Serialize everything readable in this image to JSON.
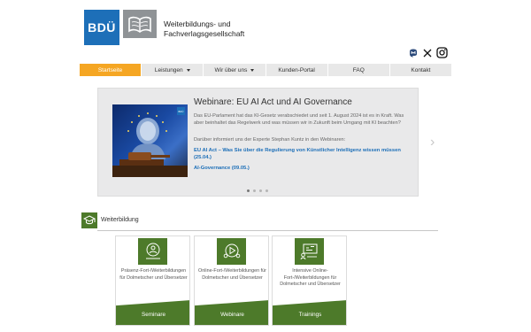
{
  "header": {
    "logo_text": "BDÜ",
    "org_line1": "Weiterbildungs- und",
    "org_line2": "Fachverlagsgesellschaft",
    "social_icons": [
      "mastodon-icon",
      "x-icon",
      "instagram-icon"
    ]
  },
  "nav": {
    "items": [
      {
        "label": "Startseite",
        "active": true,
        "dropdown": false
      },
      {
        "label": "Leistungen",
        "active": false,
        "dropdown": true
      },
      {
        "label": "Wir über uns",
        "active": false,
        "dropdown": true
      },
      {
        "label": "Kunden-Portal",
        "active": false,
        "dropdown": false
      },
      {
        "label": "FAQ",
        "active": false,
        "dropdown": false
      },
      {
        "label": "Kontakt",
        "active": false,
        "dropdown": false
      }
    ]
  },
  "slider": {
    "image_badge": "BDÜ",
    "title": "Webinare: EU AI Act und AI Governance",
    "body": "Das EU-Parlament hat das KI-Gesetz verabschiedet und seit 1. August 2024 ist es in Kraft. Was aber beinhaltet das Regelwerk und was müssen wir in Zukunft beim Umgang mit KI beachten?",
    "sub": "Darüber informiert uns der Experte Stephan Kuntz in den Webinaren:",
    "link1": "EU AI Act – Was Sie über die Regulierung von Künstlicher Intelligenz wissen müssen (25.04.)",
    "link2": "AI-Governance (09.05.)",
    "slides_total": 4,
    "current_slide": 1
  },
  "section": {
    "title": "Weiterbildung"
  },
  "cards": [
    {
      "text": "Präsenz-Fort-/Weiterbildungen für Dolmetscher und Übersetzer",
      "label": "Seminare",
      "icon": "presenter-icon"
    },
    {
      "text": "Online-Fort-/Weiterbildungen für Dolmetscher und Übersetzer",
      "label": "Webinare",
      "icon": "online-play-icon"
    },
    {
      "text": "Intensive Online-Fort-/Weiterbildungen für Dolmetscher und Übersetzer",
      "label": "Trainings",
      "icon": "training-board-icon"
    }
  ],
  "colors": {
    "brand_blue": "#1d6fb8",
    "accent_orange": "#f5a623",
    "green": "#4d7a2a",
    "gray_logo": "#8f9396"
  }
}
